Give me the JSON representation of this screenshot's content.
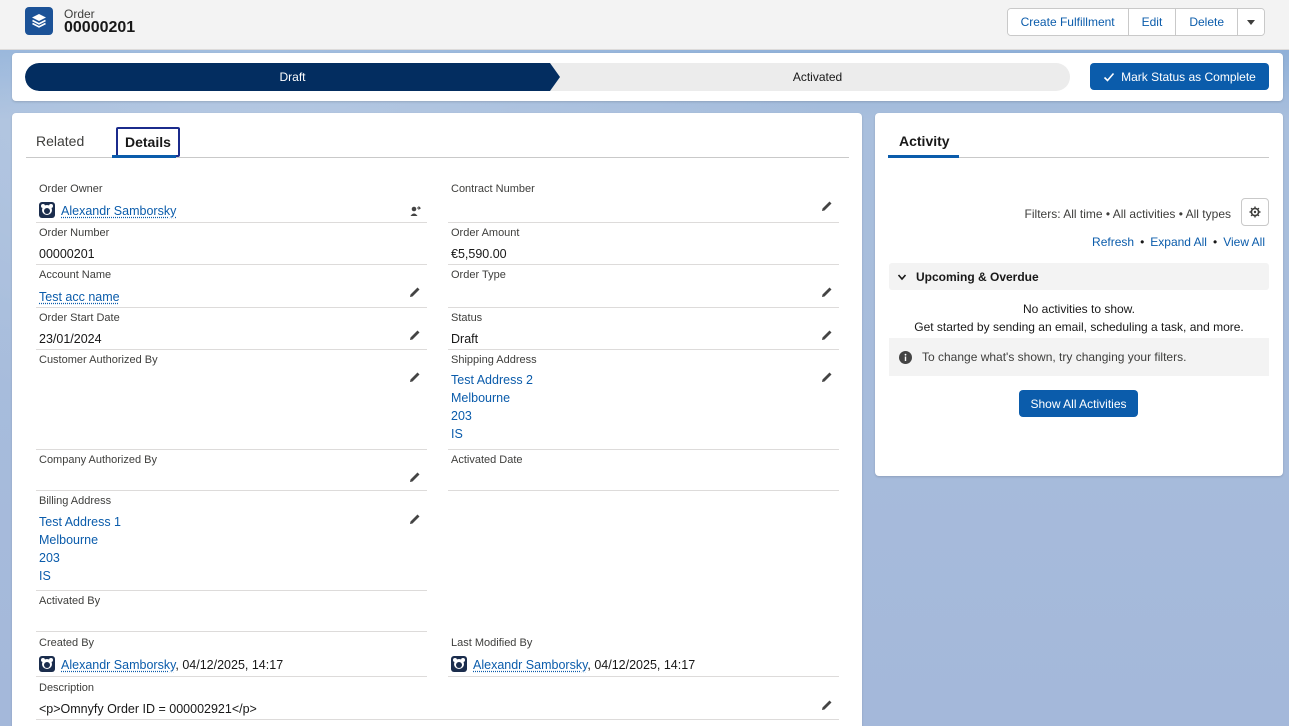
{
  "header": {
    "object_type": "Order",
    "record_name": "00000201",
    "buttons": {
      "create_fulfillment": "Create Fulfillment",
      "edit": "Edit",
      "delete": "Delete"
    },
    "icon": "layers-icon"
  },
  "path": {
    "steps": [
      {
        "label": "Draft",
        "state": "current"
      },
      {
        "label": "Activated",
        "state": "upcoming"
      }
    ],
    "mark_button": "Mark Status as Complete"
  },
  "tabs": {
    "related": "Related",
    "details": "Details",
    "selected": "Details"
  },
  "fields": {
    "order_owner": {
      "label": "Order Owner",
      "value": "Alexandr Samborsky"
    },
    "contract_number": {
      "label": "Contract Number",
      "value": ""
    },
    "order_number": {
      "label": "Order Number",
      "value": "00000201"
    },
    "order_amount": {
      "label": "Order Amount",
      "value": "€5,590.00"
    },
    "account_name": {
      "label": "Account Name",
      "value": "Test acc name"
    },
    "order_type": {
      "label": "Order Type",
      "value": ""
    },
    "order_start_date": {
      "label": "Order Start Date",
      "value": "23/01/2024"
    },
    "status": {
      "label": "Status",
      "value": "Draft"
    },
    "customer_authorized_by": {
      "label": "Customer Authorized By",
      "value": ""
    },
    "shipping_address": {
      "label": "Shipping Address",
      "lines": [
        "Test Address 2",
        "Melbourne",
        "203",
        "IS"
      ]
    },
    "company_authorized_by": {
      "label": "Company Authorized By",
      "value": ""
    },
    "activated_date": {
      "label": "Activated Date",
      "value": ""
    },
    "billing_address": {
      "label": "Billing Address",
      "lines": [
        "Test Address 1",
        "Melbourne",
        "203",
        "IS"
      ]
    },
    "activated_by": {
      "label": "Activated By",
      "value": ""
    },
    "created_by": {
      "label": "Created By",
      "user": "Alexandr Samborsky",
      "timestamp": ", 04/12/2025, 14:17"
    },
    "last_modified_by": {
      "label": "Last Modified By",
      "user": "Alexandr Samborsky",
      "timestamp": ", 04/12/2025, 14:17"
    },
    "description": {
      "label": "Description",
      "value": "<p>Omnyfy Order ID = 000002921</p>"
    }
  },
  "activity": {
    "tab": "Activity",
    "filters": "Filters: All time • All activities • All types",
    "links": {
      "refresh": "Refresh",
      "expand_all": "Expand All",
      "view_all": "View All"
    },
    "upcoming_label": "Upcoming & Overdue",
    "no_activities": "No activities to show.",
    "get_started": "Get started by sending an email, scheduling a task, and more.",
    "filter_tip": "To change what's shown, try changing your filters.",
    "show_all": "Show All Activities"
  },
  "colors": {
    "brand_blue": "#0b5cab",
    "path_active": "#032d60",
    "header_bg": "#f3f3f3",
    "page_bg": "#b0c4df"
  }
}
